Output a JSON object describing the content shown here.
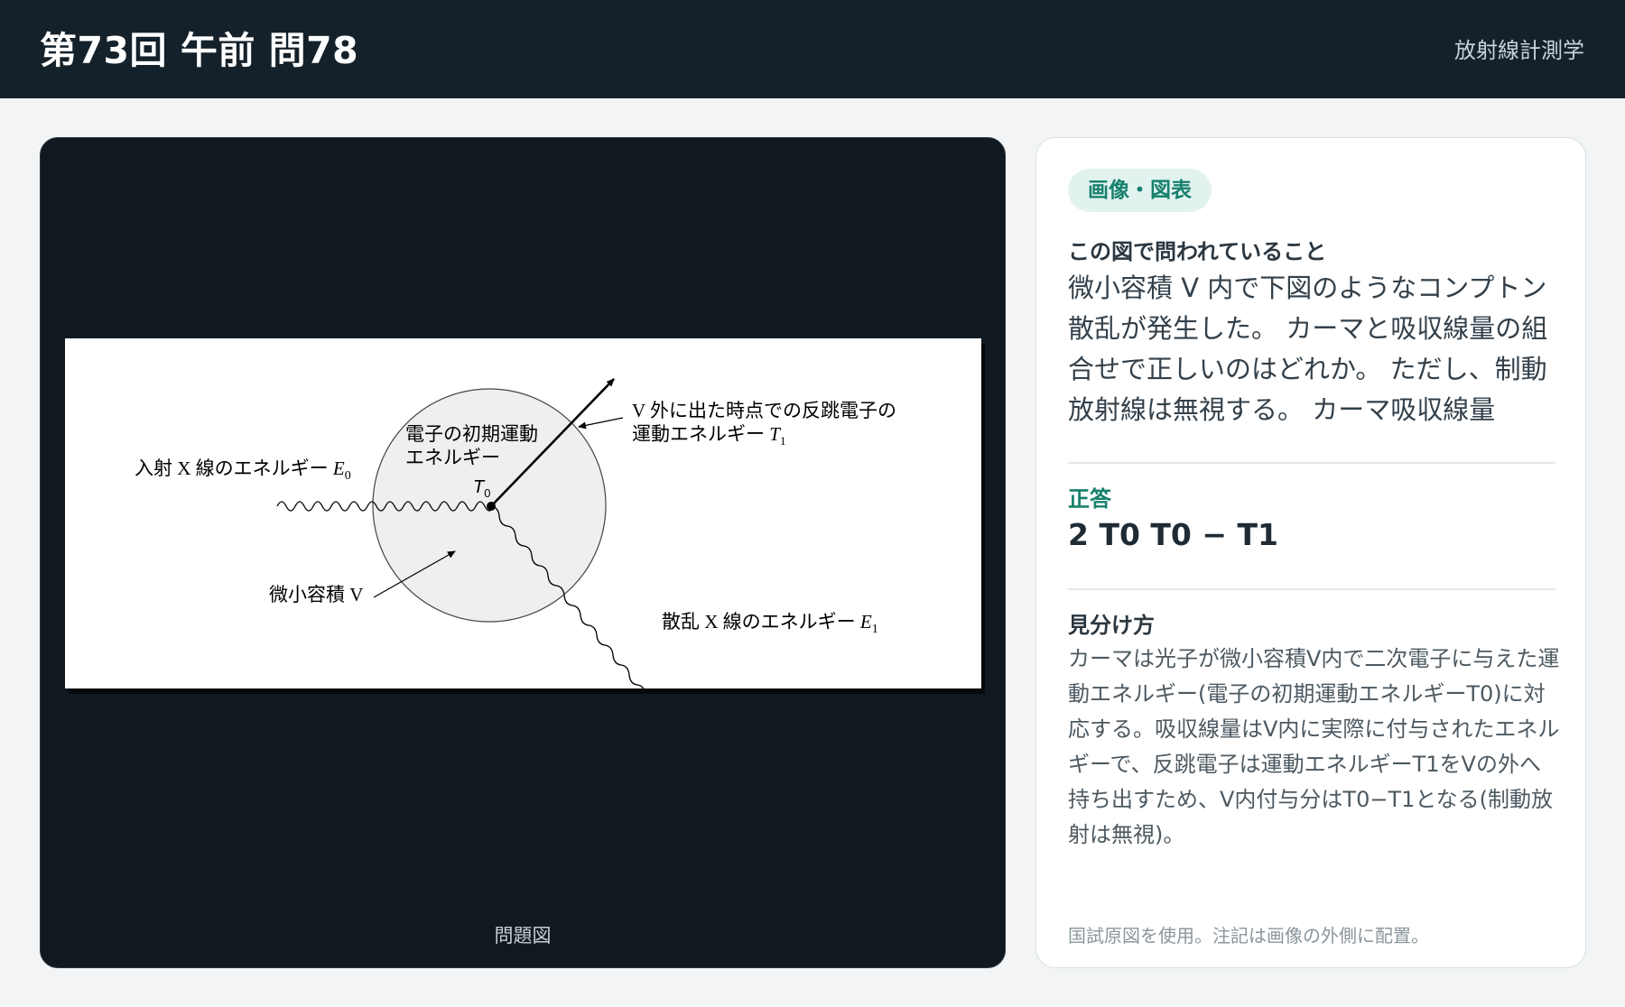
{
  "header": {
    "title": "第73回 午前 問78",
    "subject": "放射線計測学"
  },
  "figure": {
    "caption": "問題図",
    "labels": {
      "incident": "入射 X 線のエネルギー",
      "incident_sym": "E",
      "incident_sub": "0",
      "initial_ke_line1": "電子の初期運動",
      "initial_ke_line2": "エネルギー",
      "t0_sym": "T",
      "t0_sub": "0",
      "recoil_line1": "V 外に出た時点での反跳電子の",
      "recoil_line2": "運動エネルギー",
      "t1_sym": "T",
      "t1_sub": "1",
      "volume": "微小容積 V",
      "scattered": "散乱 X 線のエネルギー",
      "scattered_sym": "E",
      "scattered_sub": "1"
    }
  },
  "info": {
    "badge": "画像・図表",
    "question_heading": "この図で問われていること",
    "question_text": "微小容積 V 内で下図のようなコンプトン散乱が発生した。 カーマと吸収線量の組合せで正しいのはどれか。 ただし、制動放射線は無視する。 カーマ吸収線量",
    "answer_heading": "正答",
    "answer_value": "2 T0 T0 − T1",
    "howto_heading": "見分け方",
    "howto_text": "カーマは光子が微小容積V内で二次電子に与えた運動エネルギー(電子の初期運動エネルギーT0)に対応する。吸収線量はV内に実際に付与されたエネルギーで、反跳電子は運動エネルギーT1をVの外へ持ち出すため、V内付与分はT0−T1となる(制動放射は無視)。",
    "footnote": "国試原図を使用。注記は画像の外側に配置。"
  }
}
